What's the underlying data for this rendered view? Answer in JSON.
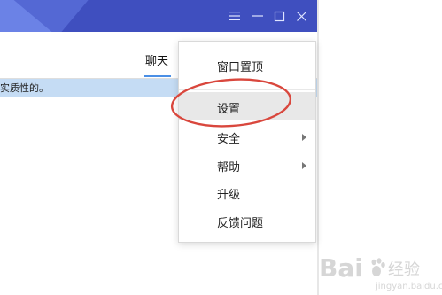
{
  "window": {
    "controls": {
      "menu_icon": "hamburger-icon",
      "minimize_icon": "minimize-icon",
      "maximize_icon": "maximize-icon",
      "close_icon": "close-icon"
    },
    "tab_label": "聊天",
    "notice_text": "实质性的。"
  },
  "menu": {
    "items": [
      {
        "label": "窗口置顶",
        "submenu": false,
        "highlighted": false
      },
      {
        "label": "设置",
        "submenu": false,
        "highlighted": true
      },
      {
        "label": "安全",
        "submenu": true,
        "highlighted": false
      },
      {
        "label": "帮助",
        "submenu": true,
        "highlighted": false
      },
      {
        "label": "升级",
        "submenu": false,
        "highlighted": false
      },
      {
        "label": "反馈问题",
        "submenu": false,
        "highlighted": false
      }
    ]
  },
  "colors": {
    "title_bar": "#3f4fbf",
    "notice_bar": "#c5dcf4",
    "tab_underline": "#4a8fe6",
    "annotation_ellipse": "#d9473d"
  }
}
